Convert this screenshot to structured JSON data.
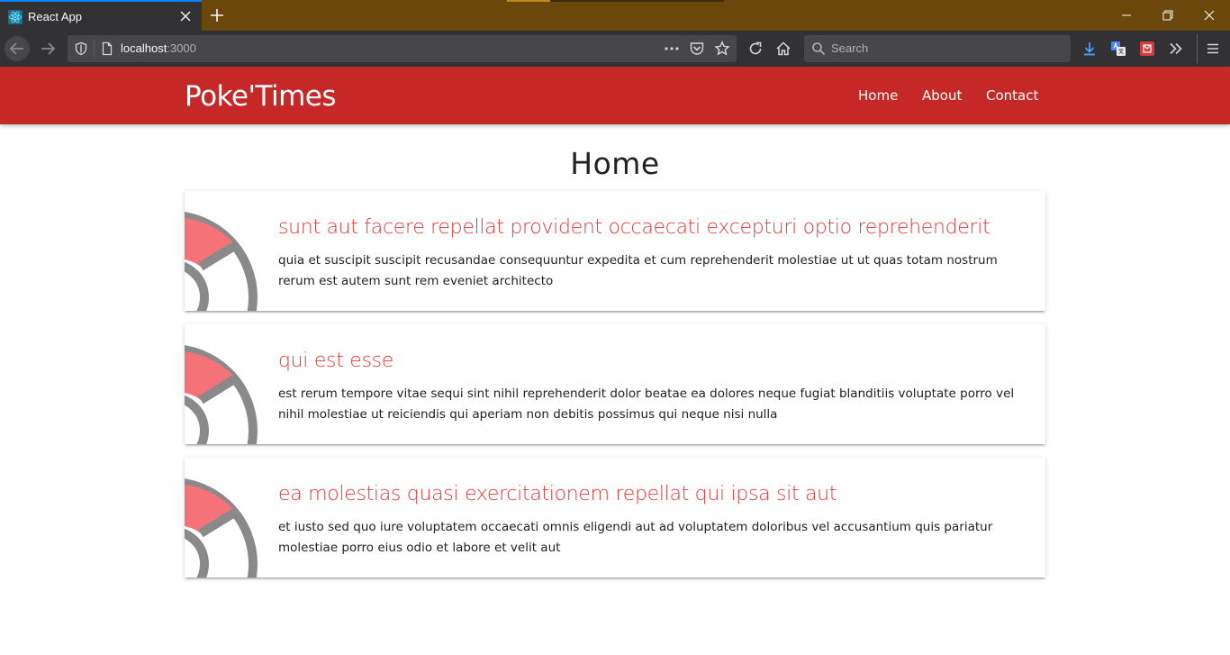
{
  "browser": {
    "tab_title": "React App",
    "url_host": "localhost",
    "url_port": ":3000",
    "search_placeholder": "Search"
  },
  "app": {
    "brand": "Poke'Times",
    "nav": [
      {
        "label": "Home"
      },
      {
        "label": "About"
      },
      {
        "label": "Contact"
      }
    ],
    "page_title": "Home",
    "accent_color": "#c62828",
    "title_color": "#e53935",
    "posts": [
      {
        "title": "sunt aut facere repellat provident occaecati excepturi optio reprehenderit",
        "body": "quia et suscipit suscipit recusandae consequuntur expedita et cum reprehenderit molestiae ut ut quas totam nostrum rerum est autem sunt rem eveniet architecto"
      },
      {
        "title": "qui est esse",
        "body": "est rerum tempore vitae sequi sint nihil reprehenderit dolor beatae ea dolores neque fugiat blanditiis voluptate porro vel nihil molestiae ut reiciendis qui aperiam non debitis possimus qui neque nisi nulla"
      },
      {
        "title": "ea molestias quasi exercitationem repellat qui ipsa sit aut",
        "body": "et iusto sed quo iure voluptatem occaecati omnis eligendi aut ad voluptatem doloribus vel accusantium quis pariatur molestiae porro eius odio et labore et velit aut"
      }
    ]
  }
}
